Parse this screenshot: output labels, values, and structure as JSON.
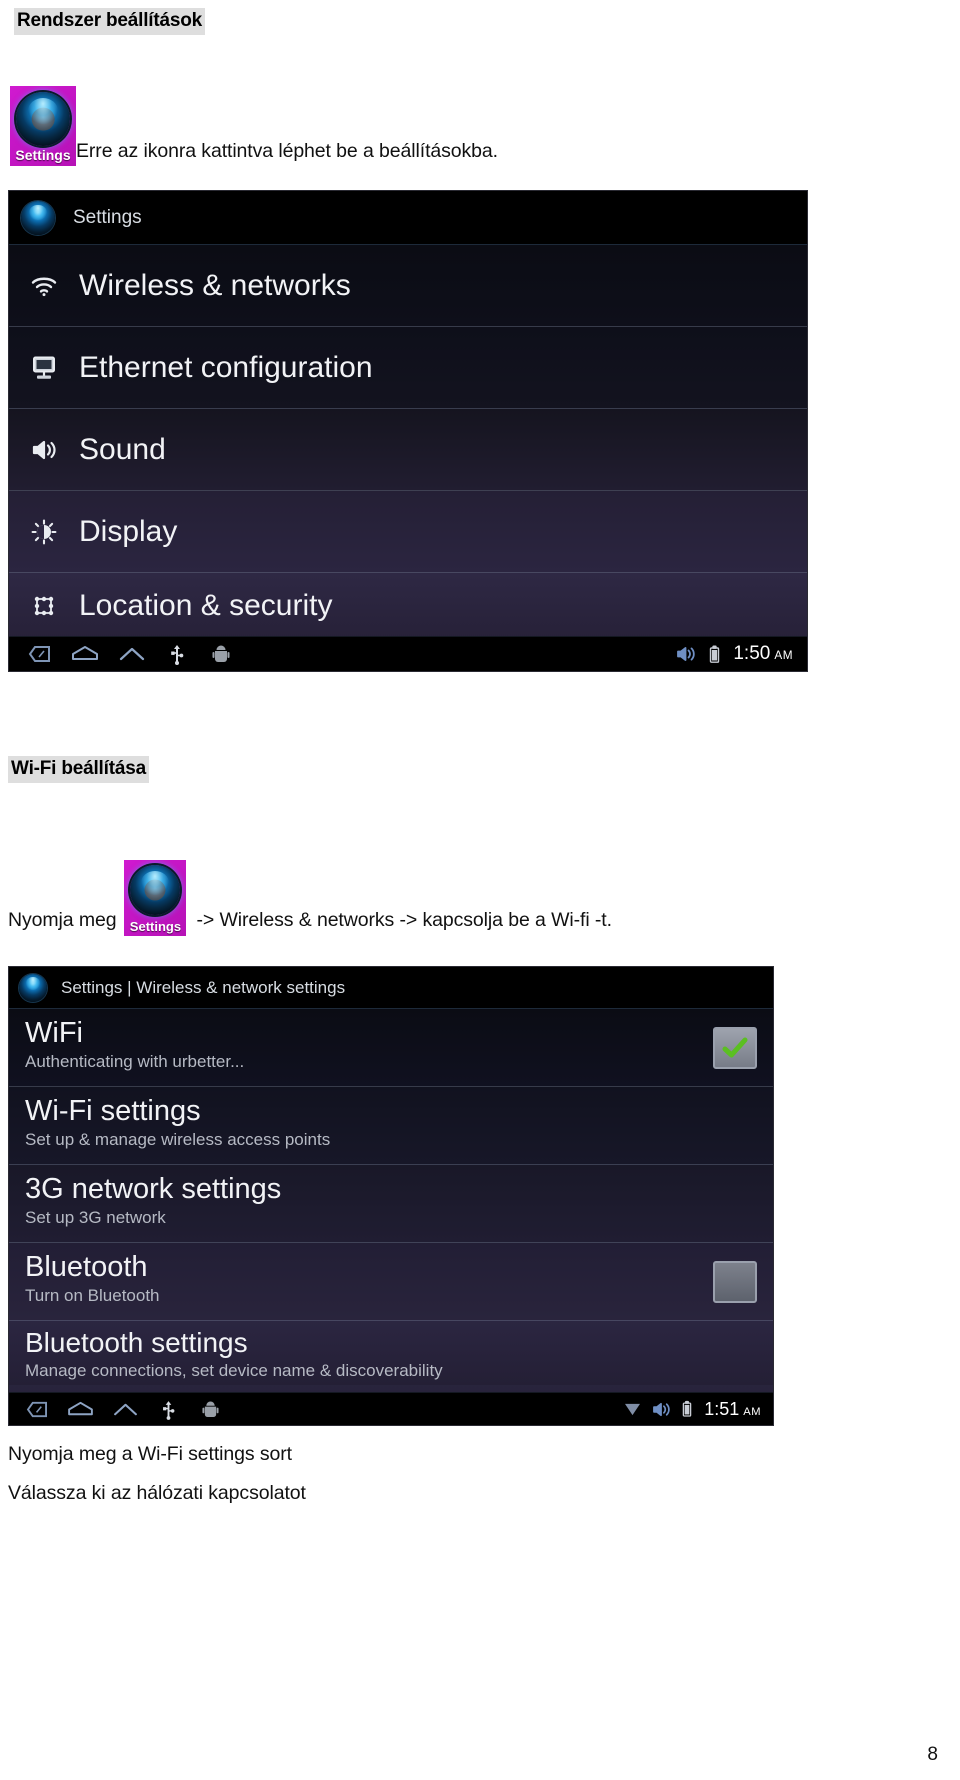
{
  "document": {
    "heading_1": "Rendszer beállítások",
    "intro_text": "Erre az ikonra kattintva léphet be a beállításokba.",
    "heading_2": "Wi-Fi beállítása",
    "wifi_instruction_prefix": "Nyomja meg",
    "wifi_instruction_suffix": "-> Wireless & networks -> kapcsolja be a Wi-fi -t.",
    "closing_line_1": "Nyomja meg a Wi-Fi settings sort",
    "closing_line_2": "Válassza ki az hálózati kapcsolatot",
    "page_number": "8"
  },
  "app_icon": {
    "caption": "Settings",
    "tile_color": "#cc19cc",
    "caption_color": "#ffffff"
  },
  "screenshot_1": {
    "titlebar": {
      "icon": "settings-orb-icon",
      "title": "Settings"
    },
    "rows": [
      {
        "icon": "wifi-icon",
        "label": "Wireless & networks"
      },
      {
        "icon": "monitor-icon",
        "label": "Ethernet configuration"
      },
      {
        "icon": "speaker-icon",
        "label": "Sound"
      },
      {
        "icon": "brightness-icon",
        "label": "Display"
      },
      {
        "icon": "location-grid-icon",
        "label": "Location & security"
      }
    ],
    "navbar": {
      "buttons": [
        "back-icon",
        "home-icon",
        "recent-apps-icon",
        "usb-icon",
        "android-debug-icon"
      ],
      "status_icons": [
        "volume-icon",
        "battery-icon"
      ],
      "clock_time": "1:50",
      "clock_ampm": "AM"
    }
  },
  "screenshot_2": {
    "titlebar": {
      "icon": "settings-orb-icon",
      "title": "Settings | Wireless & network settings"
    },
    "rows": [
      {
        "label": "WiFi",
        "sub": "Authenticating with urbetter...",
        "control": "checkbox",
        "checked": true
      },
      {
        "label": "Wi-Fi settings",
        "sub": "Set up & manage wireless access points",
        "control": "none",
        "checked": false
      },
      {
        "label": "3G network settings",
        "sub": "Set up 3G network",
        "control": "none",
        "checked": false
      },
      {
        "label": "Bluetooth",
        "sub": "Turn on Bluetooth",
        "control": "checkbox",
        "checked": false
      },
      {
        "label": "Bluetooth settings",
        "sub": "Manage connections, set device name & discoverability",
        "control": "none",
        "checked": false
      }
    ],
    "navbar": {
      "buttons": [
        "back-icon",
        "home-icon",
        "recent-apps-icon",
        "usb-icon",
        "android-debug-icon"
      ],
      "status_icons": [
        "wifi-signal-icon",
        "volume-icon",
        "battery-icon"
      ],
      "clock_time": "1:51",
      "clock_ampm": "AM"
    }
  },
  "colors": {
    "highlight": "#dedede",
    "checkbox_check": "#5bbf21",
    "screen_bg_top": "#0a0c14",
    "screen_bg_bottom": "#2c2740"
  }
}
